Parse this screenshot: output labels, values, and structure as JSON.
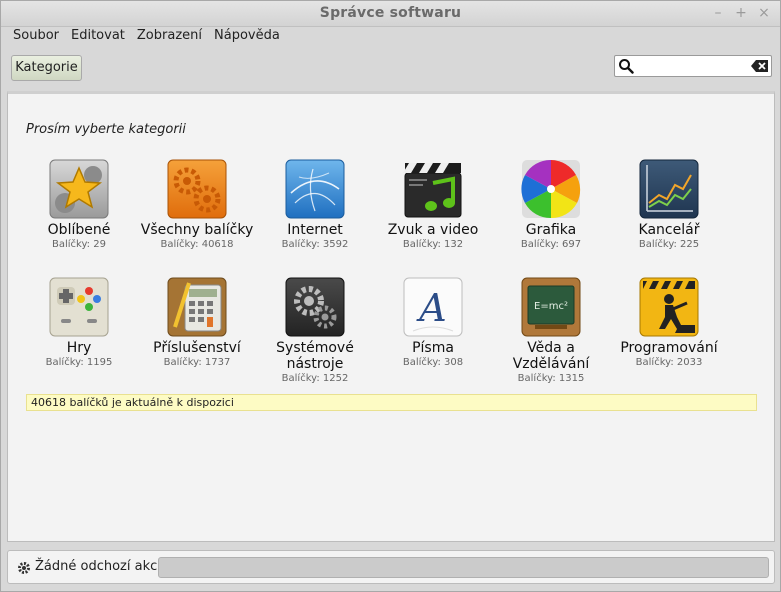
{
  "window": {
    "title": "Správce softwaru",
    "min_glyph": "–",
    "max_glyph": "+",
    "close_glyph": "×"
  },
  "menu": [
    "Soubor",
    "Editovat",
    "Zobrazení",
    "Nápověda"
  ],
  "toolbar": {
    "category_label": "Kategorie",
    "search_value": "",
    "search_placeholder": ""
  },
  "content": {
    "prompt": "Prosím vyberte kategorii",
    "categories": [
      {
        "name": "Oblíbené",
        "count": "Balíčky: 29",
        "icon": "star-icon"
      },
      {
        "name": "Všechny balíčky",
        "count": "Balíčky: 40618",
        "icon": "gears-icon"
      },
      {
        "name": "Internet",
        "count": "Balíčky: 3592",
        "icon": "globe-icon"
      },
      {
        "name": "Zvuk a video",
        "count": "Balíčky: 132",
        "icon": "clapperboard-icon"
      },
      {
        "name": "Grafika",
        "count": "Balíčky: 697",
        "icon": "color-wheel-icon"
      },
      {
        "name": "Kancelář",
        "count": "Balíčky: 225",
        "icon": "line-chart-icon"
      },
      {
        "name": "Hry",
        "count": "Balíčky: 1195",
        "icon": "gamepad-icon"
      },
      {
        "name": "Příslušenství",
        "count": "Balíčky: 1737",
        "icon": "calculator-icon"
      },
      {
        "name": "Systémové nástroje",
        "count": "Balíčky: 1252",
        "icon": "system-gears-icon"
      },
      {
        "name": "Písma",
        "count": "Balíčky: 308",
        "icon": "font-icon"
      },
      {
        "name": "Věda a Vzdělávání",
        "count": "Balíčky: 1315",
        "icon": "chalkboard-icon"
      },
      {
        "name": "Programování",
        "count": "Balíčky: 2033",
        "icon": "construction-icon"
      }
    ],
    "status": "40618 balíčků je aktuálně k dispozici"
  },
  "bottom": {
    "label": "Žádné odchozí akce",
    "progress": 0
  }
}
